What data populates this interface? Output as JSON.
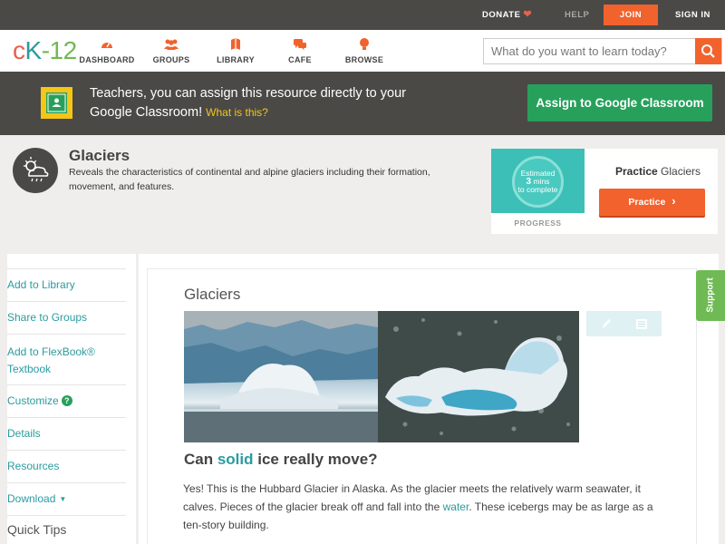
{
  "topbar": {
    "donate": "DONATE",
    "help": "HELP",
    "join": "JOIN",
    "signin": "SIGN IN"
  },
  "nav": {
    "logo": {
      "c": "c",
      "k": "K",
      "n": "-12"
    },
    "items": [
      {
        "label": "DASHBOARD",
        "icon": "dashboard-icon"
      },
      {
        "label": "GROUPS",
        "icon": "groups-icon"
      },
      {
        "label": "LIBRARY",
        "icon": "library-icon"
      },
      {
        "label": "CAFE",
        "icon": "cafe-icon"
      },
      {
        "label": "BROWSE",
        "icon": "browse-icon"
      }
    ],
    "search_placeholder": "What do you want to learn today?"
  },
  "banner": {
    "text": "Teachers, you can assign this resource directly to your Google Classroom!",
    "what_is_this": "What is this?",
    "assign_button": "Assign to Google Classroom"
  },
  "topic": {
    "title": "Glaciers",
    "description": "Reveals the characteristics of continental and alpine glaciers including their formation, movement, and features."
  },
  "practice": {
    "estimate_line1": "Estimated",
    "estimate_mins": "3",
    "estimate_line2": "mins",
    "estimate_line3": "to complete",
    "progress_label": "PROGRESS",
    "title_bold": "Practice",
    "title_rest": "Glaciers",
    "button": "Practice"
  },
  "sidebar": {
    "items": [
      {
        "label": "Add to Library"
      },
      {
        "label": "Share to Groups"
      },
      {
        "label": "Add to FlexBook® Textbook"
      },
      {
        "label": "Customize"
      },
      {
        "label": "Details"
      },
      {
        "label": "Resources"
      },
      {
        "label": "Download"
      }
    ],
    "quick_tips": "Quick Tips"
  },
  "content": {
    "section_title": "Glaciers",
    "question_pre": "Can ",
    "question_highlight": "solid",
    "question_post": " ice really move?",
    "para_1": "Yes! This is the Hubbard Glacier in Alaska. As the glacier meets the relatively warm seawater, it calves. Pieces of the glacier break off and fall into the ",
    "para_link": "water",
    "para_2": ". These icebergs may be as large as a ten-story building."
  },
  "support": "Support",
  "colors": {
    "dark_bar": "#4a4946",
    "accent_orange": "#f2622d",
    "teal": "#2b9ba0",
    "green": "#27a05b"
  }
}
